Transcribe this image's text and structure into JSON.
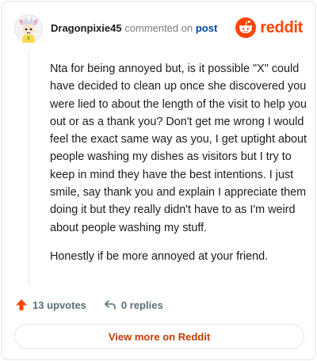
{
  "comment": {
    "author": "Dragonpixie45",
    "action_text": "commented on",
    "post_link": "post",
    "paragraphs": [
      "Nta for being annoyed but, is it possible \"X\" could have decided to clean up once she discovered you were lied to about the length of the visit to help you out or as a thank you? Don't get me wrong I would feel the exact same way as you, I get uptight about people washing my dishes as visitors but I try to keep in mind they have the best intentions. I just smile, say thank you and explain I appreciate them doing it but they really didn't have to as I'm weird about people washing my stuff.",
      "Honestly if be more annoyed at your friend."
    ]
  },
  "brand": {
    "name": "reddit",
    "color": "#ff4500"
  },
  "actions": {
    "upvotes": "13 upvotes",
    "replies": "0 replies",
    "upvote_icon": "upvote-arrow-icon",
    "reply_icon": "reply-arrow-icon"
  },
  "footer": {
    "view_more": "View more on Reddit"
  }
}
